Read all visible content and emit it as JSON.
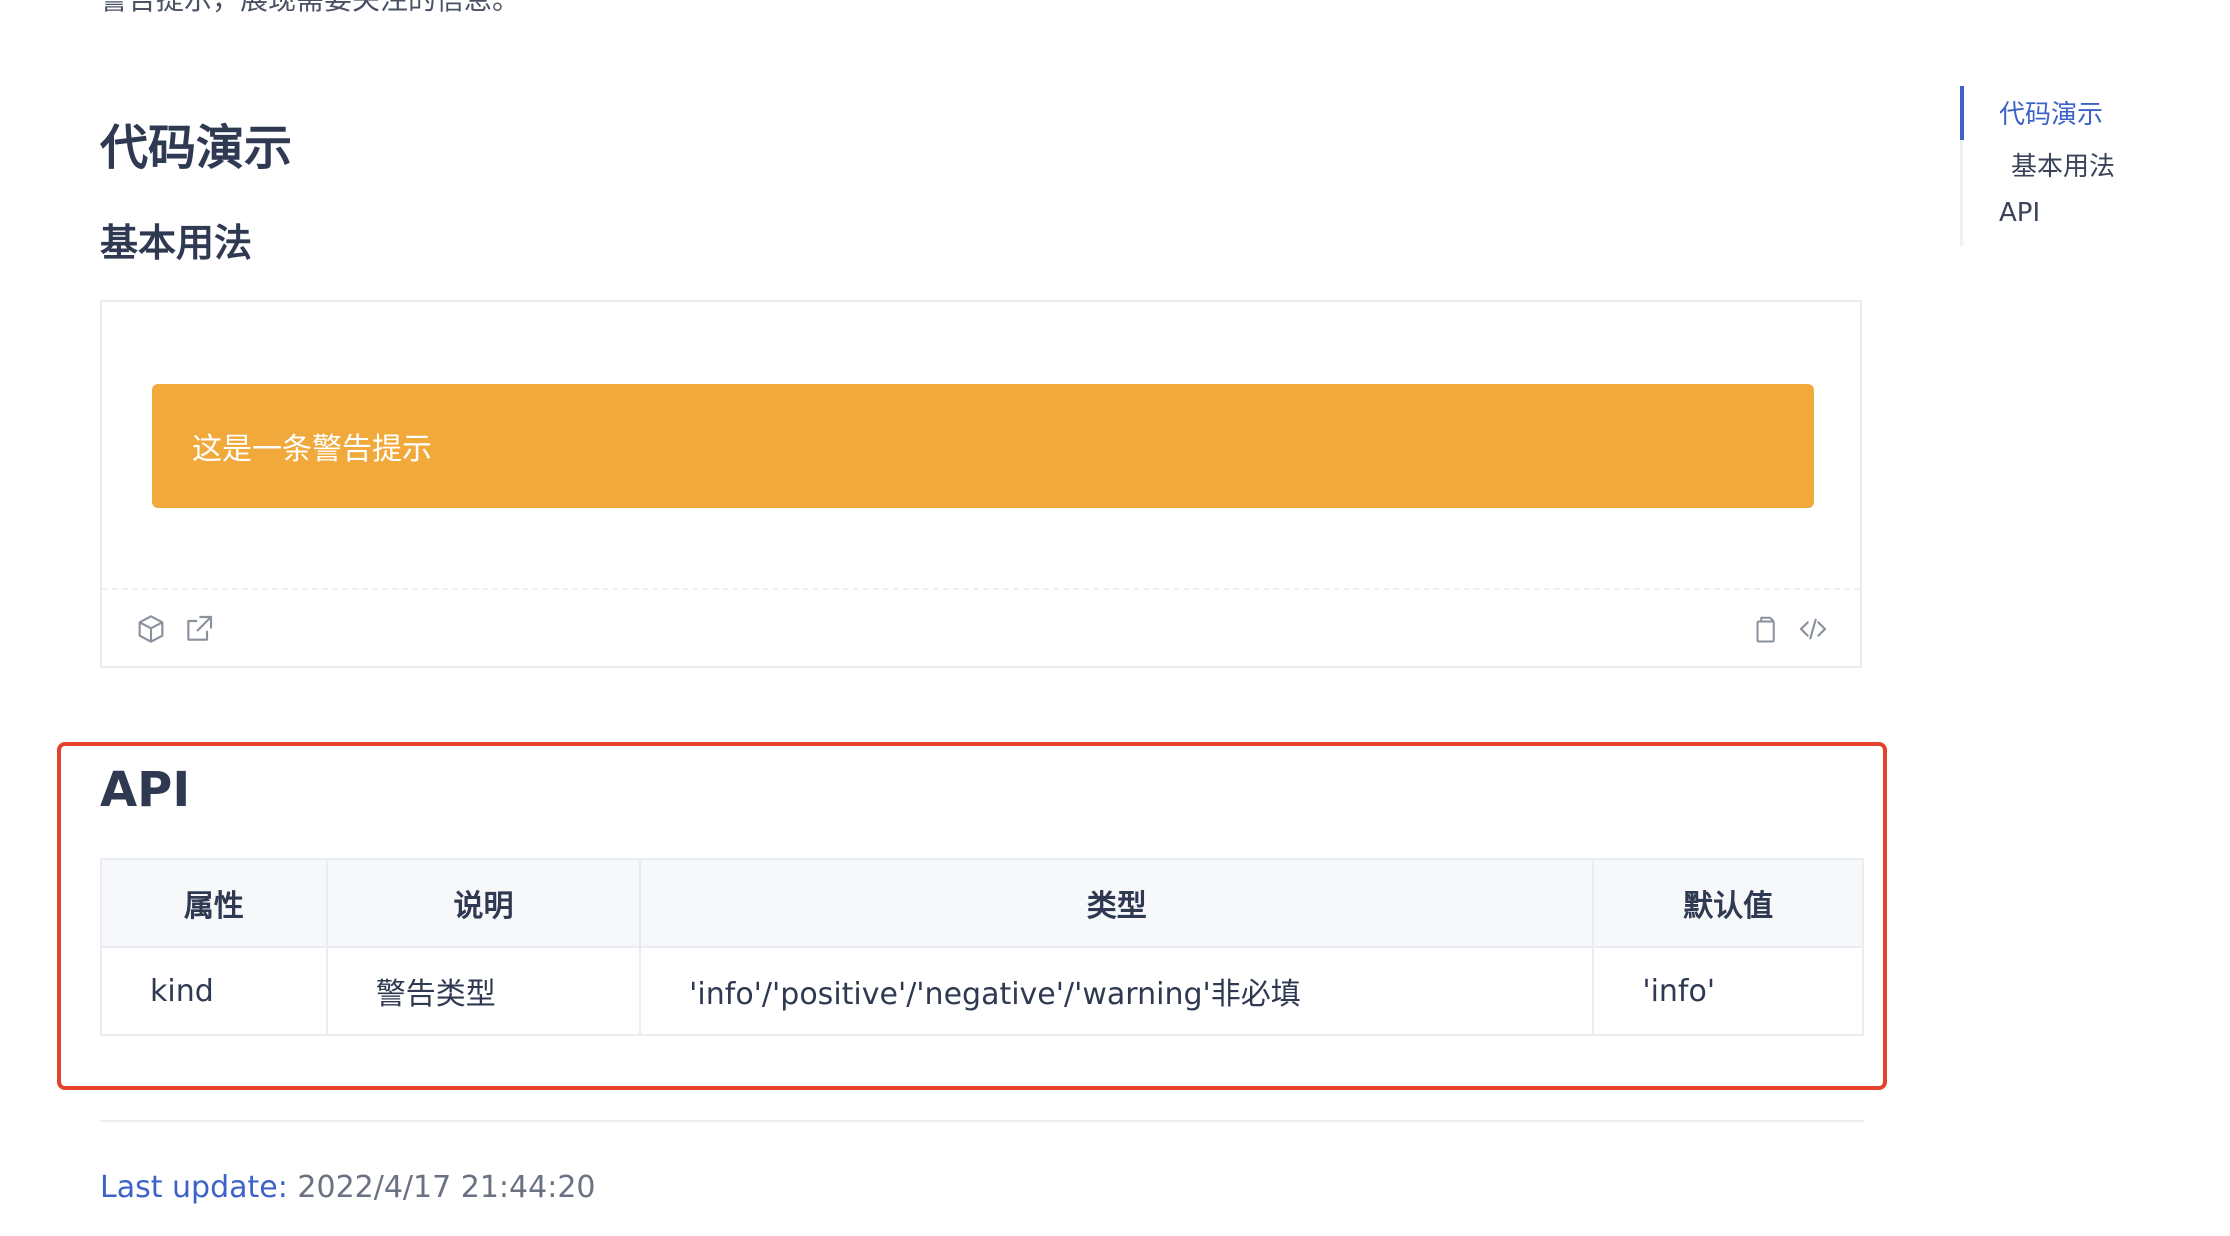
{
  "intro": {
    "text": "警告提示，展现需要关注的信息。"
  },
  "content": {
    "section_title": "代码演示",
    "subsection_title": "基本用法",
    "demo": {
      "alert_text": "这是一条警告提示",
      "alert_color": "#f1a93b",
      "toolbar_left_icons": [
        "codesandbox-icon",
        "open-external-icon"
      ],
      "toolbar_right_icons": [
        "copy-icon",
        "code-icon"
      ]
    },
    "api": {
      "title": "API",
      "headers": [
        "属性",
        "说明",
        "类型",
        "默认值"
      ],
      "rows": [
        [
          "kind",
          "警告类型",
          "'info'/'positive'/'negative'/'warning'非必填",
          "'info'"
        ]
      ]
    },
    "last_update": {
      "label": "Last update:",
      "value": "2022/4/17 21:44:20"
    }
  },
  "toc": {
    "items": [
      {
        "label": "代码演示",
        "active": true
      },
      {
        "label": "基本用法",
        "active": false
      },
      {
        "label": "API",
        "active": false
      }
    ],
    "active_color": "#3d63c9"
  },
  "colors": {
    "highlight_border": "#e5412f",
    "link": "#3d63c9"
  }
}
